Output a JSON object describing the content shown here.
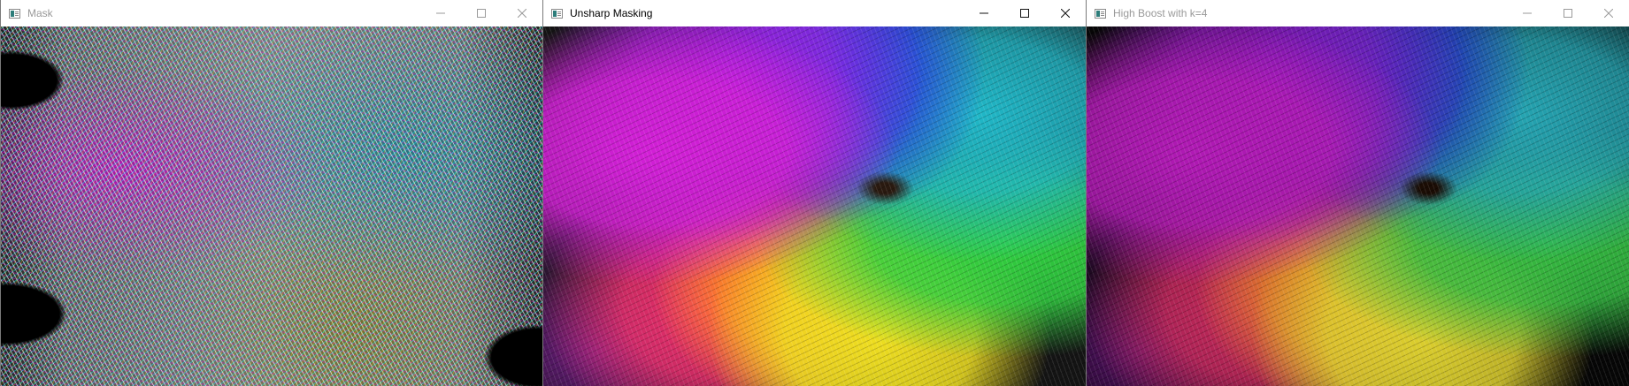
{
  "windows": [
    {
      "id": "mask",
      "title": "Mask",
      "active": false,
      "image_icon": "image-window-icon",
      "controls": {
        "minimize": "minimize-icon",
        "maximize": "maximize-icon",
        "close": "close-icon"
      }
    },
    {
      "id": "unsharp",
      "title": "Unsharp Masking",
      "active": true,
      "image_icon": "image-window-icon",
      "controls": {
        "minimize": "minimize-icon",
        "maximize": "maximize-icon",
        "close": "close-icon"
      }
    },
    {
      "id": "highboost",
      "title": "High Boost with k=4",
      "active": false,
      "image_icon": "image-window-icon",
      "controls": {
        "minimize": "minimize-icon",
        "maximize": "maximize-icon",
        "close": "close-icon"
      }
    }
  ],
  "colors": {
    "titlebar_bg": "#ffffff",
    "inactive_title": "#999999",
    "active_title": "#000000",
    "border": "#7a7a7a"
  }
}
